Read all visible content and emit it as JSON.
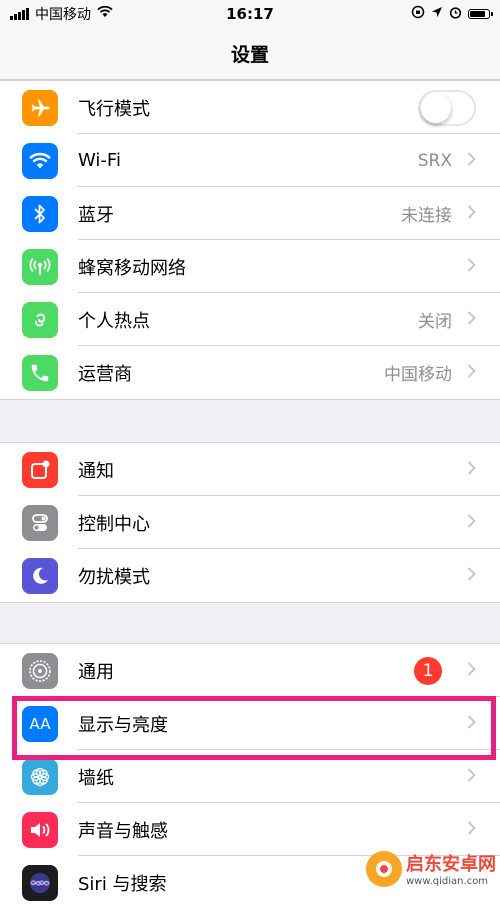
{
  "status_bar": {
    "carrier": "中国移动",
    "time": "16:17"
  },
  "nav": {
    "title": "设置"
  },
  "groups": [
    {
      "rows": [
        {
          "label": "飞行模式",
          "icon": "airplane-icon",
          "icon_color": "#ff9500",
          "toggle": "off"
        },
        {
          "label": "Wi-Fi",
          "value": "SRX",
          "icon": "wifi-icon",
          "icon_color": "#007aff"
        },
        {
          "label": "蓝牙",
          "value": "未连接",
          "icon": "bluetooth-icon",
          "icon_color": "#007aff"
        },
        {
          "label": "蜂窝移动网络",
          "value": "",
          "icon": "cellular-icon",
          "icon_color": "#4cd964"
        },
        {
          "label": "个人热点",
          "value": "关闭",
          "icon": "hotspot-icon",
          "icon_color": "#4cd964"
        },
        {
          "label": "运营商",
          "value": "中国移动",
          "icon": "phone-icon",
          "icon_color": "#4cd964"
        }
      ]
    },
    {
      "rows": [
        {
          "label": "通知",
          "icon": "notifications-icon",
          "icon_color": "#ff3b30"
        },
        {
          "label": "控制中心",
          "icon": "control-center-icon",
          "icon_color": "#8e8e93"
        },
        {
          "label": "勿扰模式",
          "icon": "moon-icon",
          "icon_color": "#5856d6"
        }
      ]
    },
    {
      "rows": [
        {
          "label": "通用",
          "badge": "1",
          "icon": "gear-icon",
          "icon_color": "#8e8e93"
        },
        {
          "label": "显示与亮度",
          "icon": "display-aa-icon",
          "icon_color": "#007aff",
          "icon_text": "AA"
        },
        {
          "label": "墙纸",
          "icon": "wallpaper-icon",
          "icon_color": "#34aadc"
        },
        {
          "label": "声音与触感",
          "icon": "sound-icon",
          "icon_color": "#ff2d55"
        },
        {
          "label": "Siri 与搜索",
          "icon": "siri-icon",
          "icon_color": "#1c1c1e"
        }
      ]
    }
  ],
  "watermark": {
    "title": "启东安卓网",
    "url": "www.qidian.com"
  },
  "colors": {
    "highlight": "#e6217f",
    "background": "#efeff4"
  }
}
